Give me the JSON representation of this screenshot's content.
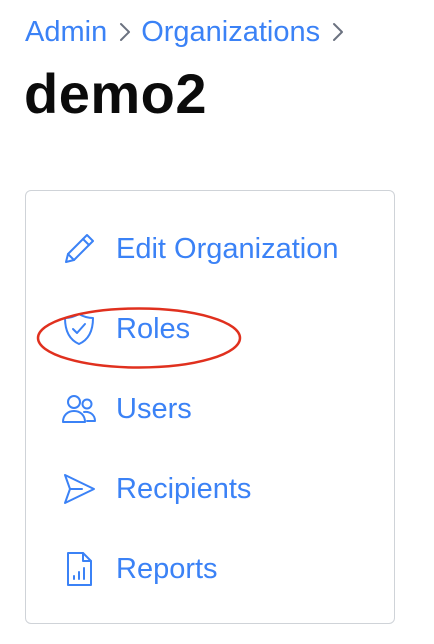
{
  "breadcrumb": {
    "items": [
      {
        "label": "Admin"
      },
      {
        "label": "Organizations"
      }
    ]
  },
  "page": {
    "title": "demo2"
  },
  "menu": {
    "items": [
      {
        "label": "Edit Organization",
        "icon": "pencil-icon"
      },
      {
        "label": "Roles",
        "icon": "shield-check-icon",
        "highlighted": true
      },
      {
        "label": "Users",
        "icon": "users-icon"
      },
      {
        "label": "Recipients",
        "icon": "send-icon"
      },
      {
        "label": "Reports",
        "icon": "report-file-icon"
      }
    ]
  },
  "colors": {
    "link": "#3b82f6",
    "title": "#0b0b0b",
    "card_border": "#cfd3d8",
    "highlight": "#e0301e",
    "separator": "#6b7280"
  }
}
